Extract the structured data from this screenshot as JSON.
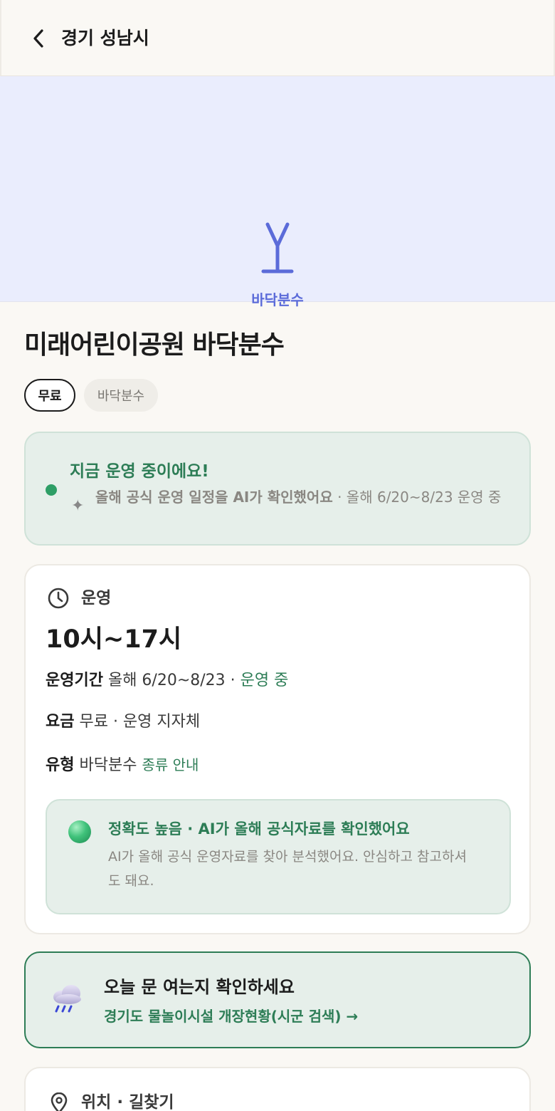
{
  "header": {
    "title": "경기 성남시",
    "back_icon": "chevron-left-icon"
  },
  "hero": {
    "label": "바닥분수",
    "icon": "fountain-icon",
    "background": "#eaedfd",
    "accent": "#5b6bd9"
  },
  "facility": {
    "name": "미래어린이공원 바닥분수",
    "chips": {
      "free": "무료",
      "type": "바닥분수"
    }
  },
  "status": {
    "title": "지금 운영 중이에요!",
    "sub_bold": "올해 공식 운영 일정을 AI가 확인했어요",
    "sub_rest": " · 올해 6/20~8/23 운영 중",
    "color": "#2d7d56"
  },
  "operation": {
    "label": "운영",
    "hours": "10시~17시",
    "period_key": "운영기간",
    "period_value": " 올해 6/20~8/23 · ",
    "period_status": "운영 중",
    "fee_key": "요금",
    "fee_value": " 무료 · 운영 지자체",
    "type_key": "유형",
    "type_value": " 바닥분수 ",
    "type_link": "종류 안내",
    "accuracy": {
      "title": "정확도 높음 · AI가 올해 공식자료를 확인했어요",
      "description": "AI가 올해 공식 운영자료를 찾아 분석했어요. 안심하고 참고하셔도 돼요."
    }
  },
  "alert": {
    "icon": "rain-cloud-icon",
    "title": "오늘 문 여는지 확인하세요",
    "link": "경기도 물놀이시설 개장현황(시군 검색) →"
  },
  "location": {
    "title": "위치 · 길찾기",
    "icon": "map-pin-icon"
  }
}
